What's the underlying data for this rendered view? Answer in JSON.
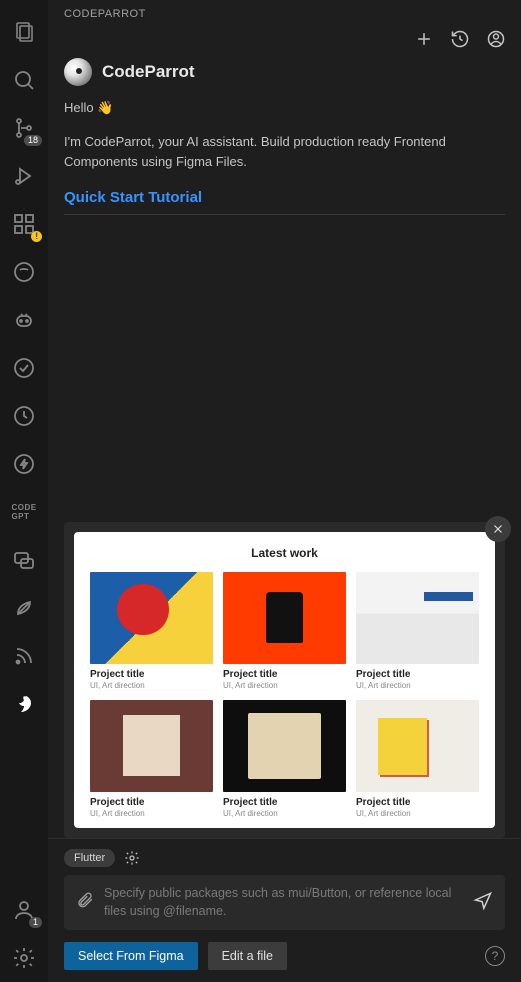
{
  "header": {
    "tab_label": "CODEPARROT"
  },
  "brand": {
    "name": "CodeParrot"
  },
  "greeting": "Hello 👋",
  "intro": "I'm CodeParrot, your AI assistant. Build production ready Frontend Components using Figma Files.",
  "quick_start": "Quick Start Tutorial",
  "sidebar": {
    "source_badge": "18",
    "account_badge": "1"
  },
  "popup": {
    "title": "Latest work",
    "items": [
      {
        "title": "Project title",
        "sub": "UI, Art direction"
      },
      {
        "title": "Project title",
        "sub": "UI, Art direction"
      },
      {
        "title": "Project title",
        "sub": "UI, Art direction"
      },
      {
        "title": "Project title",
        "sub": "UI, Art direction"
      },
      {
        "title": "Project title",
        "sub": "UI, Art direction"
      },
      {
        "title": "Project title",
        "sub": "UI, Art direction"
      }
    ]
  },
  "input": {
    "tag": "Flutter",
    "placeholder": "Specify public packages such as mui/Button, or reference local files using @filename."
  },
  "actions": {
    "primary": "Select From Figma",
    "secondary": "Edit a file",
    "help": "?"
  }
}
